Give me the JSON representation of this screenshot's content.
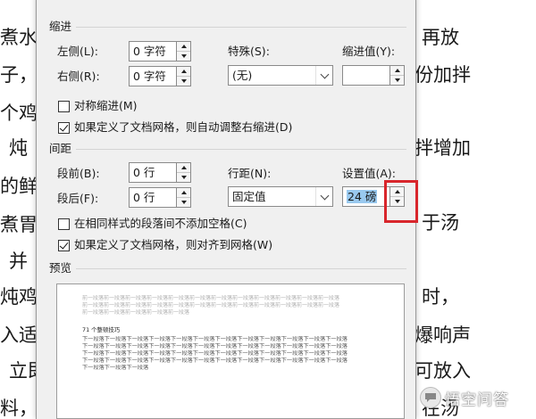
{
  "background_text": {
    "left": [
      "煮水",
      "子，",
      "个鸡",
      "炖",
      "的鲜",
      "煮胃",
      "并",
      "炖鸡",
      "入适",
      "立即",
      "料，"
    ],
    "right": [
      "再放",
      "份加拌",
      "",
      "拌增加",
      "",
      "于汤",
      "",
      "时，",
      "爆响声",
      "可放入",
      "在汤"
    ]
  },
  "dialog": {
    "indent": {
      "section": "缩进",
      "left_label": "左侧(L):",
      "left_value": "0 字符",
      "right_label": "右侧(R):",
      "right_value": "0 字符",
      "special_label": "特殊(S):",
      "special_value": "(无)",
      "indent_value_label": "缩进值(Y):",
      "indent_value": "",
      "mirror_label": "对称缩进(M)",
      "mirror_checked": false,
      "auto_adjust_label": "如果定义了文档网格，则自动调整右缩进(D)",
      "auto_adjust_checked": true
    },
    "spacing": {
      "section": "间距",
      "before_label": "段前(B):",
      "before_value": "0 行",
      "after_label": "段后(F):",
      "after_value": "0 行",
      "line_spacing_label": "行距(N):",
      "line_spacing_value": "固定值",
      "set_value_label": "设置值(A):",
      "set_value": "24 磅",
      "no_space_label": "在相同样式的段落间不添加空格(C)",
      "no_space_checked": false,
      "snap_grid_label": "如果定义了文档网格，则对齐到网格(W)",
      "snap_grid_checked": true
    },
    "preview": {
      "section": "预览",
      "prev_line1": "前一段落前一段落前一段落前一段落前一段落前一段落前一段落前一段落前一段落前一段落前一段落前一段落",
      "prev_line2": "前一段落前一段落前一段落前一段落前一段落前一段落前一段落前一段落前一段落前一段落前一段落前一段落",
      "prev_line3": "前一段落前一段落前一段落前一段落前一段落",
      "sample": "71 个整顿技巧",
      "next_line1": "下一段落下一段落下一段落下一段落下一段落下一段落下一段落下一段落下一段落下一段落下一段落下一段落",
      "next_line2": "下一段落下一段落下一段落下一段落下一段落下一段落下一段落下一段落下一段落下一段落下一段落下一段落",
      "next_line3": "下一段落下一段落下一段落下一段落下一段落下一段落下一段落下一段落下一段落下一段落下一段落下一段落",
      "next_line4": "下一段落下一段落下一段落下一段落下一段落下一段落下一段落下一段落下一段落下一段落下一段落下一段落",
      "next_line5": "下一段落下一段落下一段落"
    }
  },
  "watermark": {
    "text": "悟空问答",
    "icon": "chat-bubble-icon"
  },
  "colors": {
    "highlight": "#d8262c",
    "selection": "#99c9ef",
    "dialog_bg": "#f0f0f0"
  }
}
